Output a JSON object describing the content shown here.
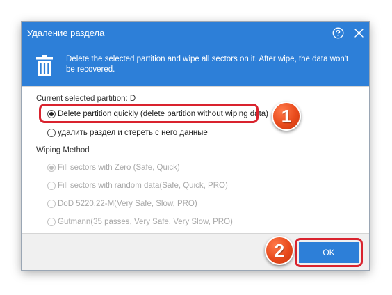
{
  "dialog": {
    "title": "Удаление раздела",
    "help_icon": "question-circle-icon",
    "close_icon": "close-icon",
    "banner": {
      "icon": "trash-icon",
      "message": "Delete the selected partition and wipe all sectors on it. After wipe, the data won't be recovered."
    },
    "current_partition_label": "Current selected partition: D",
    "options": [
      {
        "label": "Delete partition quickly (delete partition without wiping data)",
        "selected": true
      },
      {
        "label": "удалить раздел и стереть с него данные",
        "selected": false
      }
    ],
    "wiping_method_label": "Wiping Method",
    "wiping_methods": [
      {
        "label": "Fill sectors with Zero (Safe, Quick)",
        "selected": true
      },
      {
        "label": "Fill sectors with random data(Safe, Quick, PRO)",
        "selected": false
      },
      {
        "label": "DoD 5220.22-M(Very Safe, Slow, PRO)",
        "selected": false
      },
      {
        "label": "Gutmann(35 passes, Very Safe, Very Slow, PRO)",
        "selected": false
      }
    ],
    "ok_label": "OK"
  },
  "annotations": {
    "step1": "1",
    "step2": "2",
    "highlight_color": "#d9232e",
    "badge_color": "#e84a1c"
  },
  "colors": {
    "accent": "#2d7fd8",
    "footer_bg": "#f0f0f0",
    "disabled_text": "#a8a8a8"
  }
}
